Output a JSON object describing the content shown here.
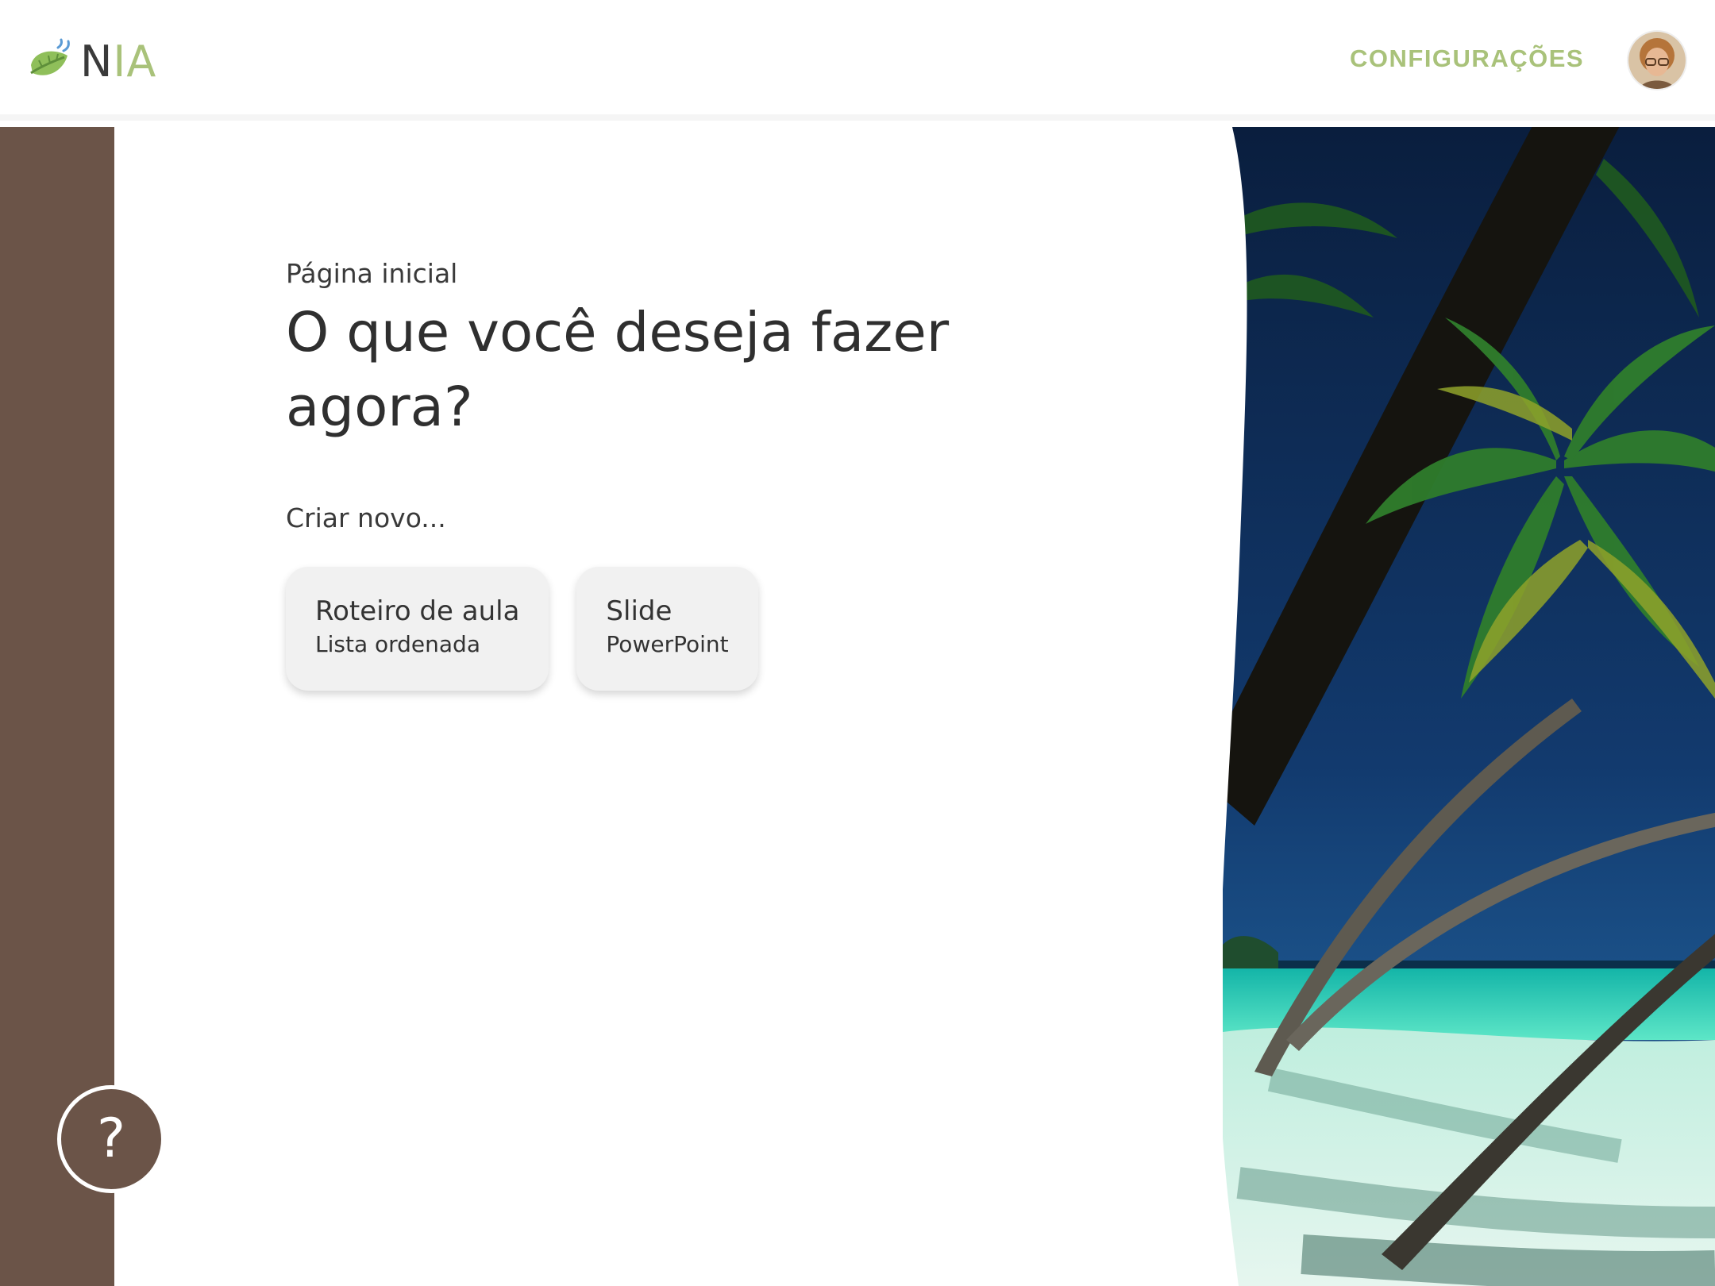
{
  "app": {
    "logo": {
      "letter_n": "N",
      "letters_ia": "IA"
    }
  },
  "header": {
    "settings_label": "CONFIGURAÇÕES"
  },
  "main": {
    "breadcrumb": "Página inicial",
    "title": "O que você deseja fazer agora?",
    "create_label": "Criar novo...",
    "cards": [
      {
        "title": "Roteiro de aula",
        "subtitle": "Lista ordenada"
      },
      {
        "title": "Slide",
        "subtitle": "PowerPoint"
      }
    ]
  },
  "help": {
    "label": "?"
  },
  "icons": {
    "logo": "leaf-icon",
    "help": "question-mark-icon",
    "avatar": "user-avatar"
  },
  "colors": {
    "accent_green": "#a9c27a",
    "sidebar_brown": "#6b5448",
    "card_bg": "#f1f1f1",
    "text_dark": "#2f2f2f"
  }
}
